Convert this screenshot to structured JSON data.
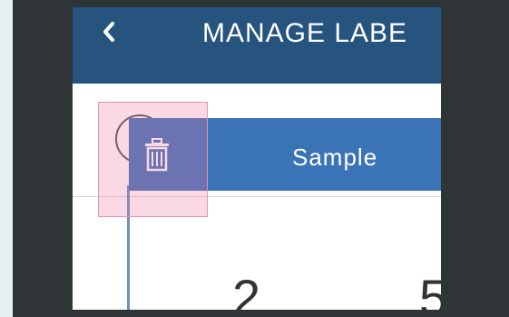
{
  "header": {
    "back_icon": "chevron-left-icon",
    "title": "MANAGE LABE"
  },
  "label_item": {
    "delete_icon": "trash-icon",
    "name": "Sample"
  },
  "partial_digits": [
    "2",
    "5"
  ],
  "colors": {
    "header_bg": "#26547f",
    "item_bg": "#3a74b6",
    "highlight": "#e890b2",
    "backdrop": "#2f3436"
  }
}
